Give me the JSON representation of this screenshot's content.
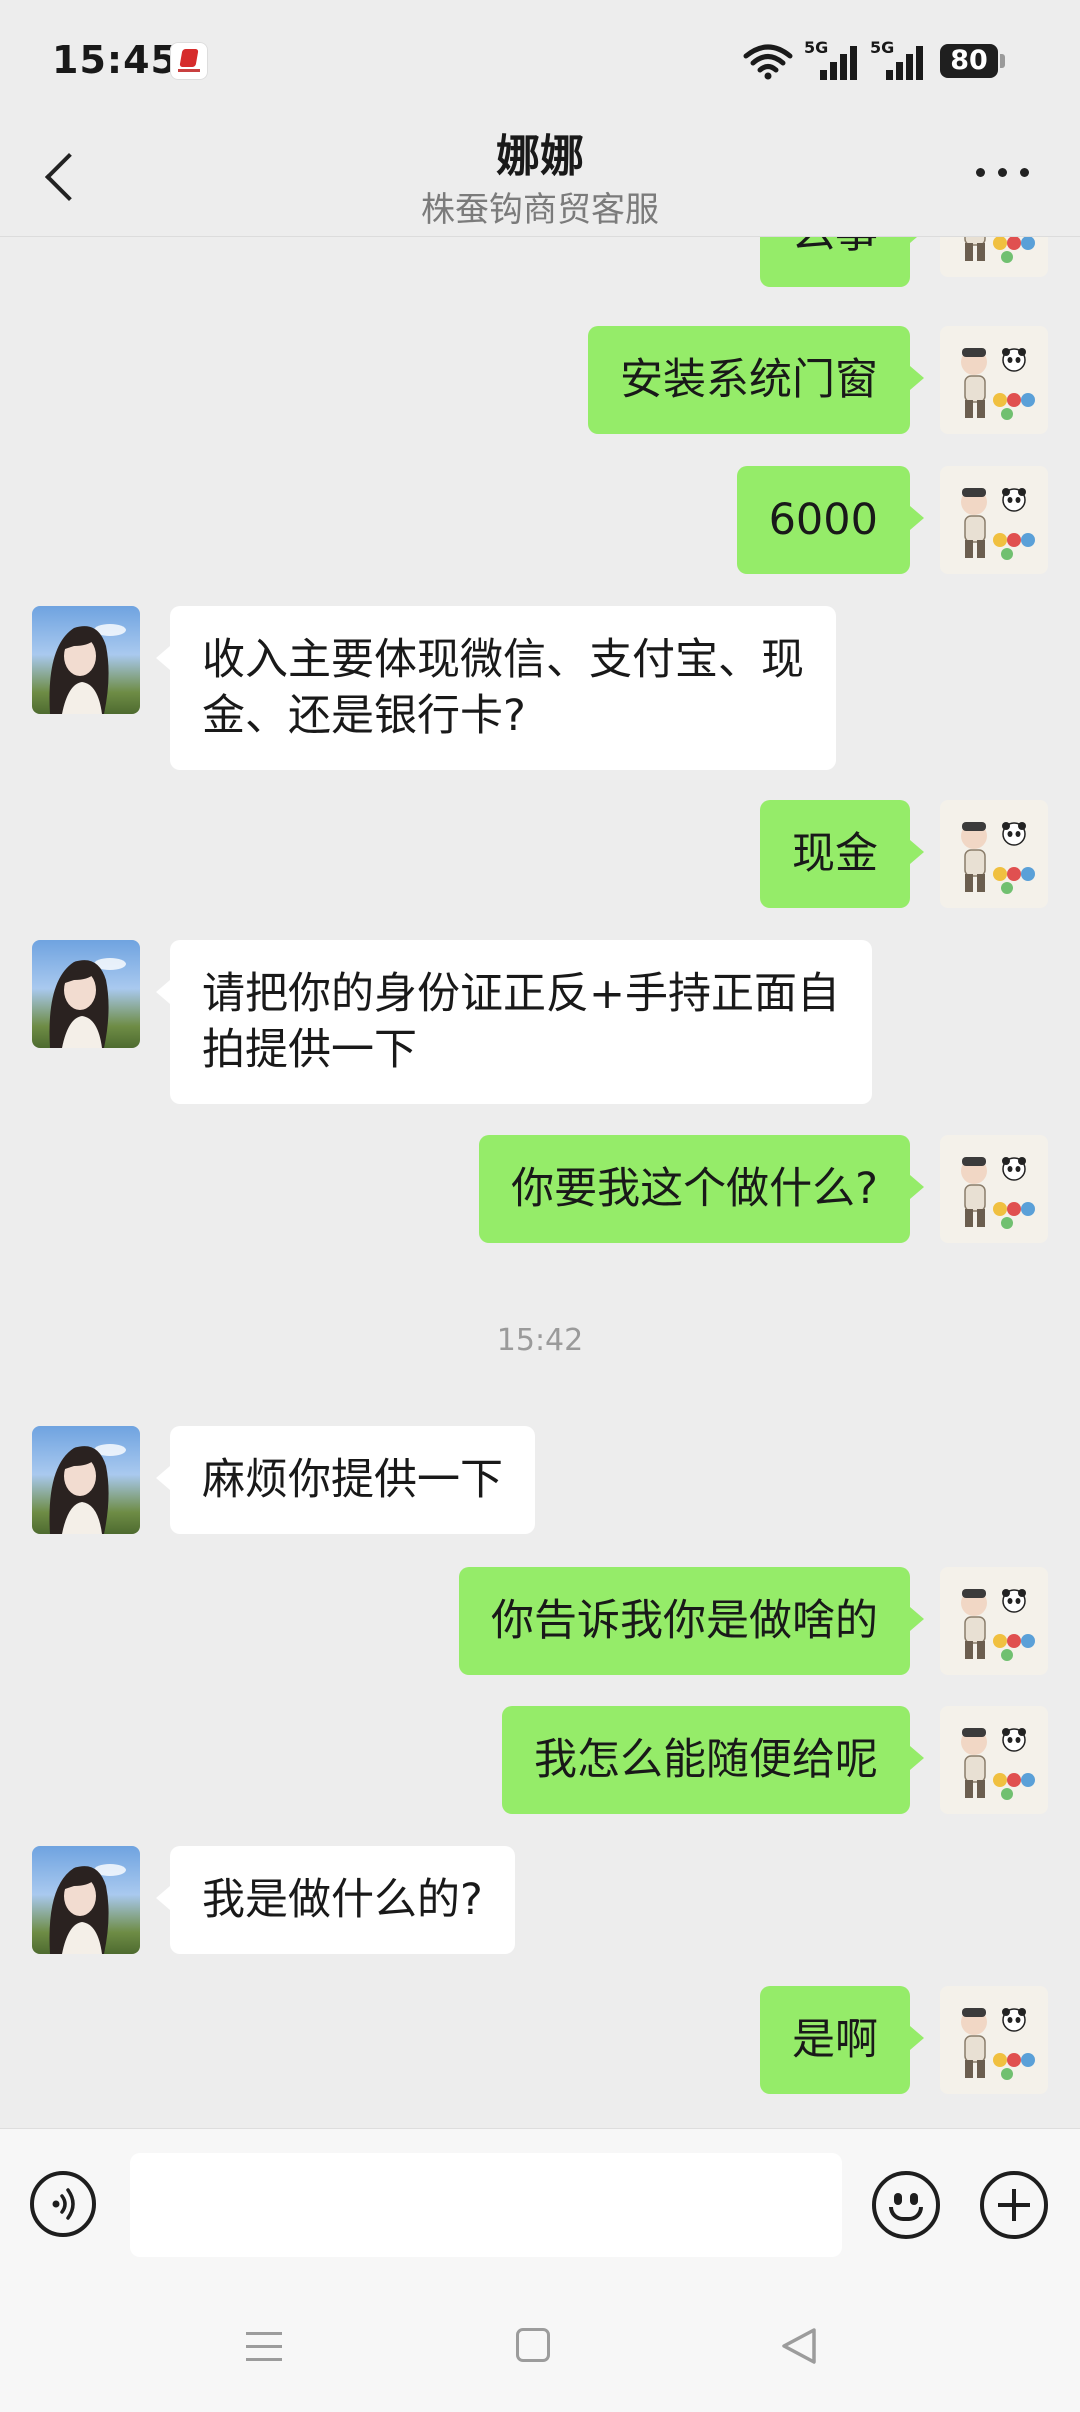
{
  "status_bar": {
    "time": "15:45",
    "network_1": "5G",
    "network_2": "5G",
    "battery": "80"
  },
  "header": {
    "title": "娜娜",
    "subtitle": "株蚕钩商贸客服"
  },
  "messages": [
    {
      "side": "me",
      "text": "么事"
    },
    {
      "side": "me",
      "text": "安装系统门窗"
    },
    {
      "side": "me",
      "text": "6000"
    },
    {
      "side": "her",
      "lines": [
        "收入主要体现微信、支付宝、现",
        "金、还是银行卡?"
      ]
    },
    {
      "side": "me",
      "text": "现金"
    },
    {
      "side": "her",
      "lines": [
        "请把你的身份证正反+手持正面自",
        "拍提供一下"
      ]
    },
    {
      "side": "me",
      "text": "你要我这个做什么?"
    },
    {
      "timestamp": "15:42"
    },
    {
      "side": "her",
      "text": "麻烦你提供一下"
    },
    {
      "side": "me",
      "text": "你告诉我你是做啥的"
    },
    {
      "side": "me",
      "text": "我怎么能随便给呢"
    },
    {
      "side": "her",
      "text": "我是做什么的?"
    },
    {
      "side": "me",
      "text": "是啊"
    }
  ],
  "input": {
    "value": ""
  },
  "icons": {
    "back": "chevron-left-icon",
    "more": "more-dots-icon",
    "voice": "voice-icon",
    "emoji": "emoji-icon",
    "plus": "plus-icon",
    "nav_menu": "menu-icon",
    "nav_home": "home-square-icon",
    "nav_back": "back-triangle-icon"
  },
  "colors": {
    "outgoing_bubble": "#95ec69",
    "incoming_bubble": "#ffffff",
    "background": "#ededed"
  }
}
